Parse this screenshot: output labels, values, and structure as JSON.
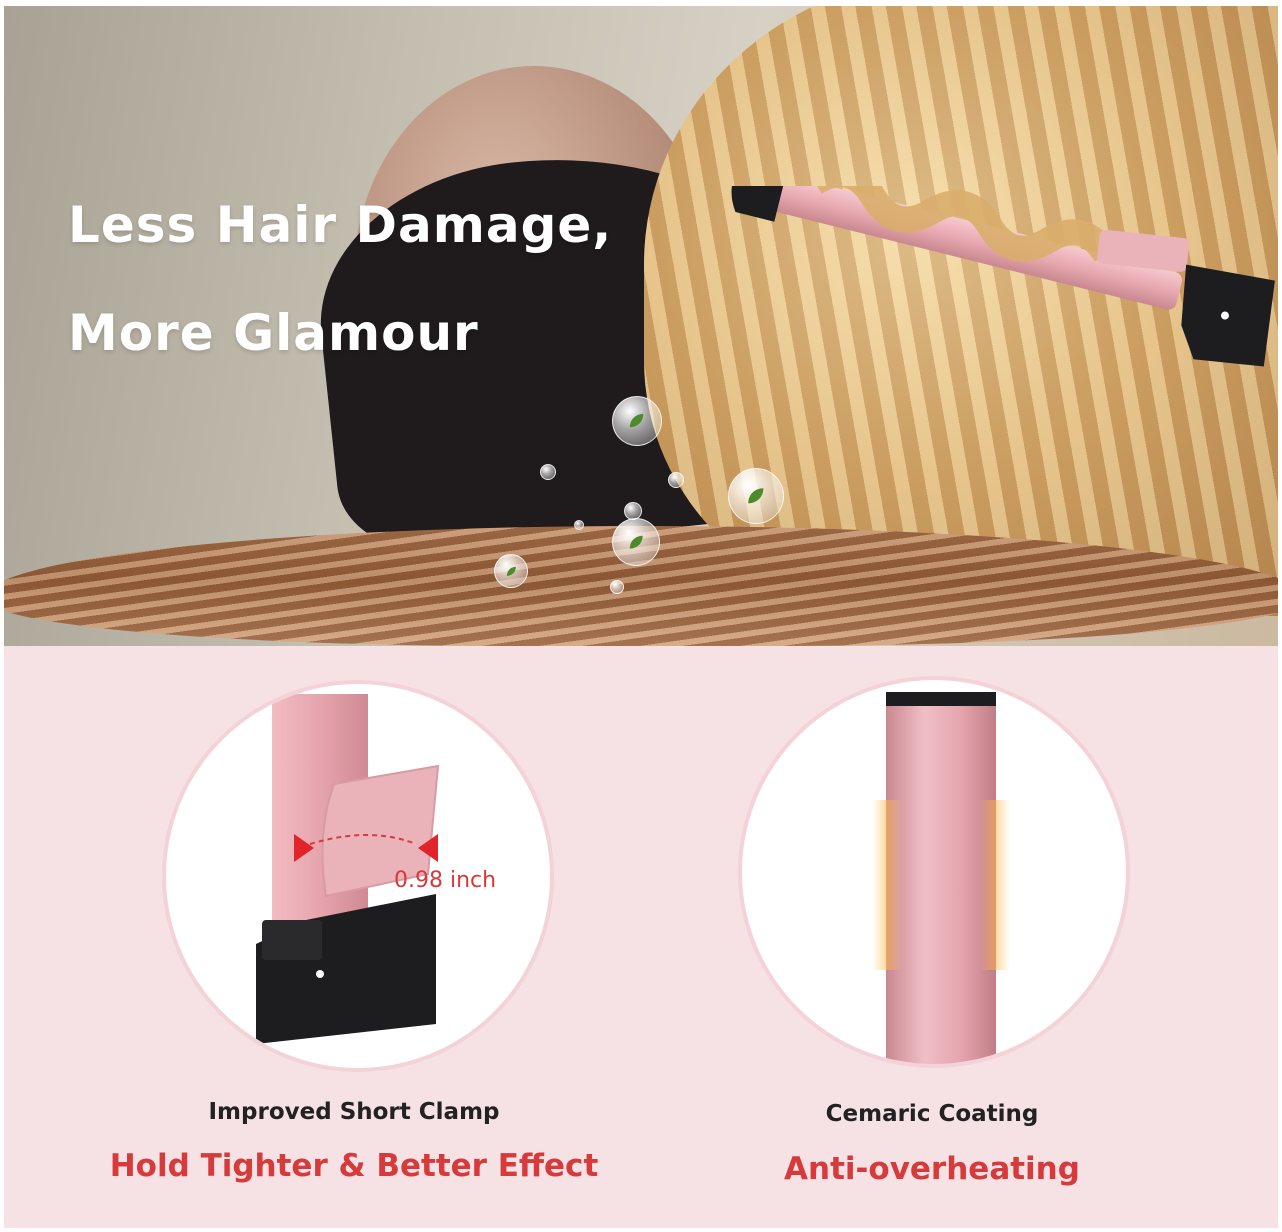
{
  "hero": {
    "headline_line1": "Less Hair Damage,",
    "headline_line2": "More Glamour"
  },
  "features": [
    {
      "title": "Improved Short Clamp",
      "subtitle": "Hold Tighter & Better Effect",
      "measurement": "0.98 inch"
    },
    {
      "title": "Cemaric Coating",
      "subtitle": "Anti-overheating"
    }
  ],
  "colors": {
    "accent_red": "#d63a3a",
    "panel_pink": "#f6e1e4",
    "wand_pink": "#e8a9b0",
    "wand_black": "#1d1d1f"
  }
}
